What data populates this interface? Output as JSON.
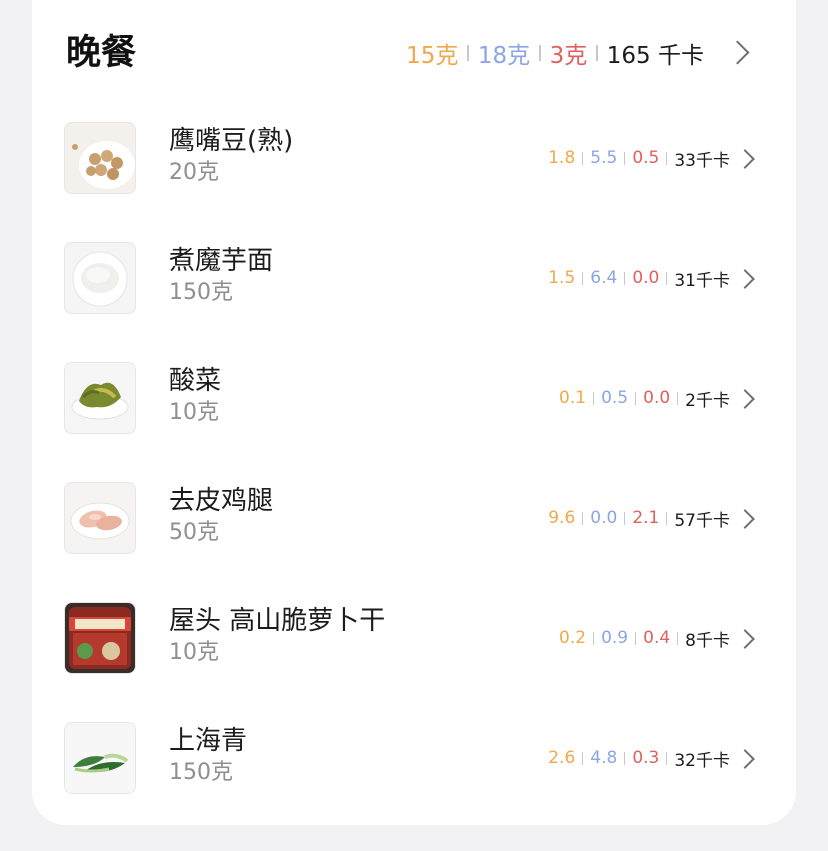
{
  "meal": {
    "title": "晚餐",
    "carbs": "15克",
    "protein": "18克",
    "fat": "3克",
    "calories": "165 千卡"
  },
  "colors": {
    "carbs": "#f0a84a",
    "protein": "#8ca5e6",
    "fat": "#e0605c"
  },
  "items": [
    {
      "name": "鹰嘴豆(熟)",
      "amount": "20克",
      "carbs": "1.8",
      "protein": "5.5",
      "fat": "0.5",
      "calories": "33千卡",
      "icon": "chickpeas-photo"
    },
    {
      "name": "煮魔芋面",
      "amount": "150克",
      "carbs": "1.5",
      "protein": "6.4",
      "fat": "0.0",
      "calories": "31千卡",
      "icon": "konjac-noodles-photo"
    },
    {
      "name": "酸菜",
      "amount": "10克",
      "carbs": "0.1",
      "protein": "0.5",
      "fat": "0.0",
      "calories": "2千卡",
      "icon": "pickled-cabbage-photo"
    },
    {
      "name": "去皮鸡腿",
      "amount": "50克",
      "carbs": "9.6",
      "protein": "0.0",
      "fat": "2.1",
      "calories": "57千卡",
      "icon": "chicken-leg-photo"
    },
    {
      "name": "屋头 高山脆萝卜干",
      "amount": "10克",
      "carbs": "0.2",
      "protein": "0.9",
      "fat": "0.4",
      "calories": "8千卡",
      "icon": "radish-jar-photo"
    },
    {
      "name": "上海青",
      "amount": "150克",
      "carbs": "2.6",
      "protein": "4.8",
      "fat": "0.3",
      "calories": "32千卡",
      "icon": "bok-choy-photo"
    }
  ]
}
